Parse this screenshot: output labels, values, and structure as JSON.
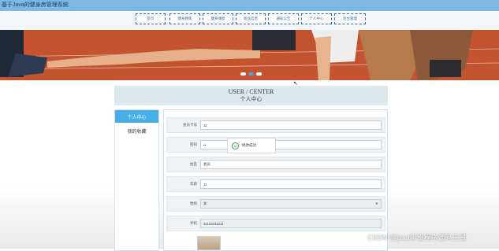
{
  "app": {
    "title": "基于Java的健身房管理系统"
  },
  "nav": {
    "items": [
      "首页",
      "健身教练",
      "健身课程",
      "新品信息",
      "通知公告",
      "个人中心",
      "后台管理"
    ]
  },
  "banner": {
    "slides": 3,
    "active_slide": 2
  },
  "center": {
    "title_en": "USER / CENTER",
    "title_cn": "个人中心"
  },
  "sidebar": {
    "items": [
      {
        "label": "个人中心",
        "active": true
      },
      {
        "label": "我的收藏",
        "active": false
      }
    ]
  },
  "form": {
    "fields": [
      {
        "label": "会员卡号",
        "value": "11"
      },
      {
        "label": "密码",
        "value": "••"
      },
      {
        "label": "姓名",
        "value": "会员"
      },
      {
        "label": "年龄",
        "value": "11"
      },
      {
        "label": "性别",
        "value": "女"
      },
      {
        "label": "手机",
        "value": "11122211111"
      }
    ]
  },
  "toast": {
    "message": "修改成功"
  },
  "watermark": "CSDN @java毕设程序源码王哥",
  "colors": {
    "topbar": "#7db7e4",
    "accent": "#4aaee6",
    "nav_border": "#2f6aa8",
    "success": "#2f9e44"
  },
  "icons": {
    "select_arrow": "chevron-down-icon",
    "toast_icon": "smile-icon"
  }
}
